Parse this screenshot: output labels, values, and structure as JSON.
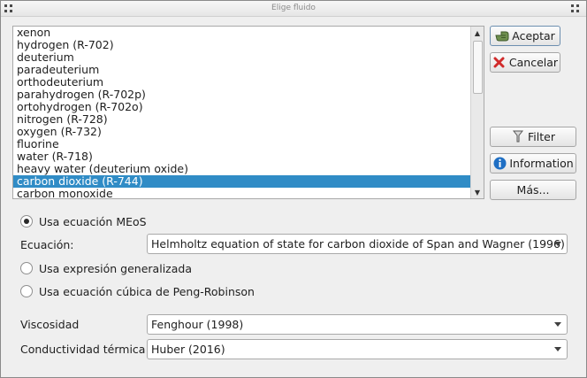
{
  "window": {
    "title": "Elige fluido"
  },
  "fluid_list": {
    "items": [
      "xenon",
      "hydrogen (R-702)",
      "deuterium",
      "paradeuterium",
      "orthodeuterium",
      "parahydrogen (R-702p)",
      "ortohydrogen (R-702o)",
      "nitrogen (R-728)",
      "oxygen (R-732)",
      "fluorine",
      "water (R-718)",
      "heavy water (deuterium oxide)",
      "carbon dioxide (R-744)",
      "carbon monoxide"
    ],
    "selected": "carbon dioxide (R-744)"
  },
  "buttons": {
    "accept": "Aceptar",
    "cancel": "Cancelar",
    "filter": "Filter",
    "information": "Information",
    "more": "Más..."
  },
  "options": {
    "meos_label": "Usa ecuación MEoS",
    "meos_checked": true,
    "equation_label": "Ecuación:",
    "equation_value": "Helmholtz equation of state for carbon dioxide of Span and Wagner (1996)",
    "generalized_label": "Usa expresión generalizada",
    "generalized_checked": false,
    "cubic_label": "Usa ecuación cúbica de Peng-Robinson",
    "cubic_checked": false
  },
  "transport": {
    "viscosity_label": "Viscosidad",
    "viscosity_value": "Fenghour (1998)",
    "conductivity_label": "Conductividad térmica",
    "conductivity_value": "Huber (2016)"
  },
  "colors": {
    "selection": "#308cc6",
    "info_icon": "#1f6fc4",
    "cancel_icon": "#d12b2b"
  }
}
